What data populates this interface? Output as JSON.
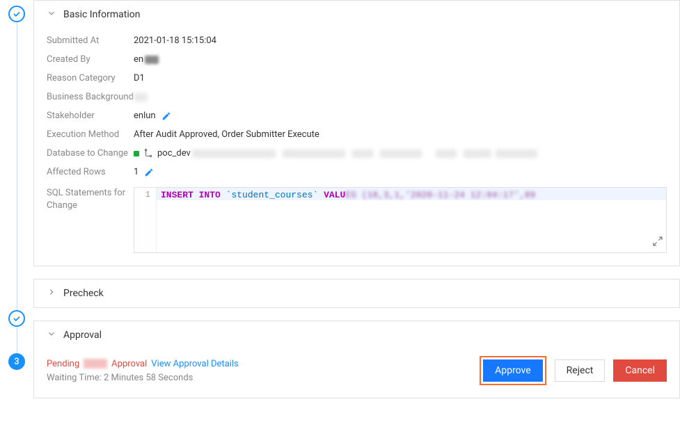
{
  "sections": {
    "basic": {
      "title": "Basic Information",
      "fields": {
        "submitted_at": {
          "label": "Submitted At",
          "value": "2021-01-18 15:15:04"
        },
        "created_by": {
          "label": "Created By",
          "value": "en"
        },
        "reason_category": {
          "label": "Reason Category",
          "value": "D1"
        },
        "business_bg": {
          "label": "Business Background",
          "value": ""
        },
        "stakeholder": {
          "label": "Stakeholder",
          "value": "enlun"
        },
        "execution_method": {
          "label": "Execution Method",
          "value": "After Audit Approved, Order Submitter Execute"
        },
        "database_to_change": {
          "label": "Database to Change",
          "value_prefix": "poc_dev"
        },
        "affected_rows": {
          "label": "Affected Rows",
          "value": "1"
        },
        "sql": {
          "label": "SQL Statements for Change",
          "line": "1",
          "kw1": "INSERT INTO",
          "table": "`student_courses`",
          "kw2": "VALU"
        }
      }
    },
    "precheck": {
      "title": "Precheck"
    },
    "approval": {
      "title": "Approval",
      "step_number": "3",
      "pending": "Pending",
      "approval_word": "Approval",
      "view_details": "View Approval Details",
      "waiting_line": "Waiting Time:  2 Minutes 58 Seconds",
      "actions": {
        "approve": "Approve",
        "reject": "Reject",
        "cancel": "Cancel"
      }
    }
  }
}
